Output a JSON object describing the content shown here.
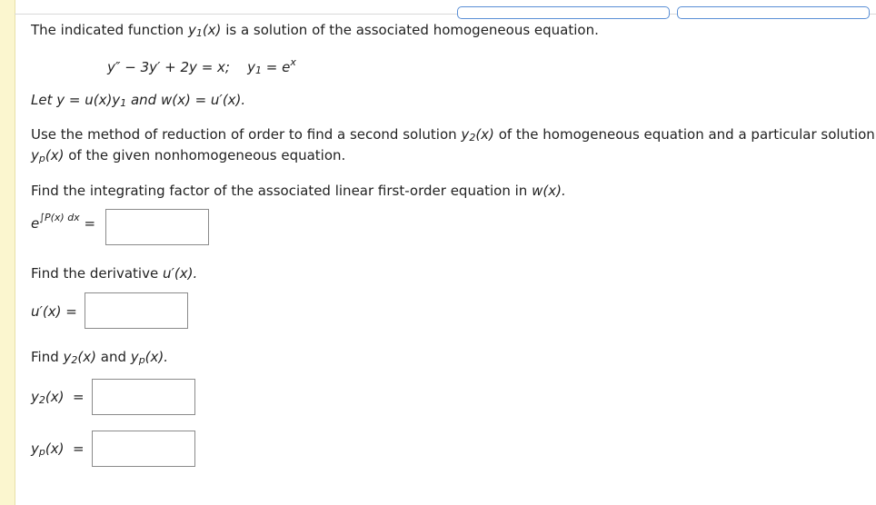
{
  "intro": "The indicated function",
  "intro_rest": "is a solution of the associated homogeneous equation.",
  "equation": "y″ − 3y′ + 2y = x;",
  "y1_def": "= e",
  "let_line_a": "Let y = u(x)y",
  "let_line_b": "and w(x) = u′(x).",
  "method_line1a": "Use the method of reduction of order to find a second solution",
  "method_line1b": "of the homogeneous equation and a particular solution",
  "method_line2b": "of the given nonhomogeneous equation.",
  "integrating_prompt_a": "Find the integrating factor of the associated linear first-order equation in",
  "integrating_prompt_b": "w(x).",
  "derivative_prompt_a": "Find the derivative",
  "derivative_prompt_b": "u′(x).",
  "find_y_prompt": "Find",
  "and_word": "and",
  "eq_sign": "=",
  "inputs": {
    "integrating_factor": "",
    "u_prime": "",
    "y2": "",
    "yp": ""
  }
}
